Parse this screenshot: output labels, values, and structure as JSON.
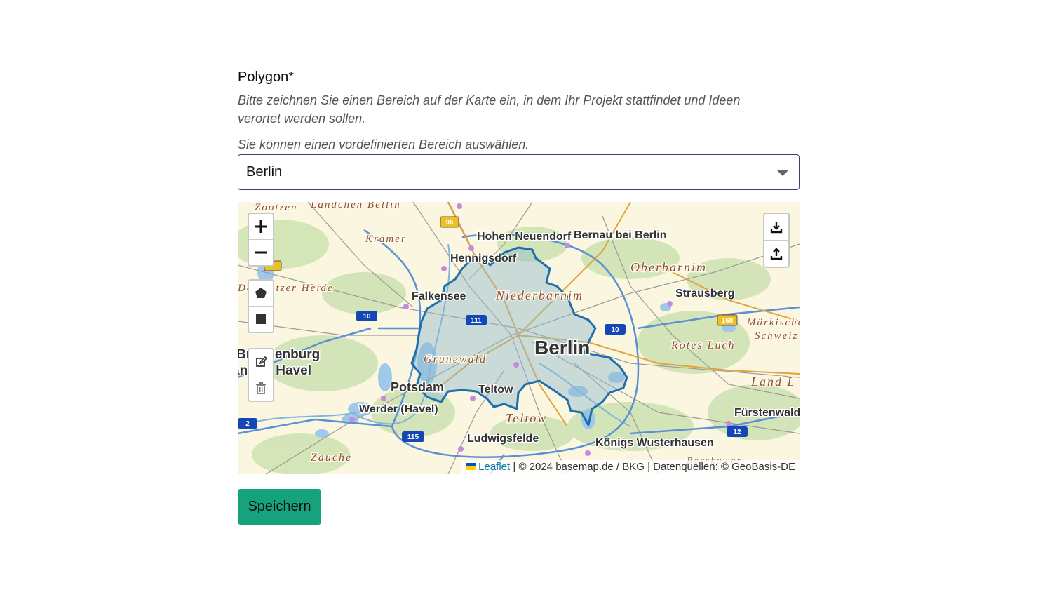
{
  "form": {
    "label": "Polygon*",
    "help": "Bitte zeichnen Sie einen Bereich auf der Karte ein, in dem Ihr Projekt stattfindet und Ideen verortet werden sollen.",
    "preset_hint": "Sie können einen vordefinierten Bereich auswählen.",
    "preset_value": "Berlin",
    "save_label": "Speichern"
  },
  "map": {
    "places": {
      "zootzen": "Zootzen",
      "landchen": "Ländchen Bellin",
      "kramer": "Krämer",
      "hohen": "Hohen Neuendorf",
      "bernau": "Bernau bei Berlin",
      "hennigsdorf": "Hennigsdorf",
      "oberbarnim": "Oberbarnim",
      "heide": "Döberitzer Heide",
      "falkensee": "Falkensee",
      "niederbarnim": "Niederbarnim",
      "strausberg": "Strausberg",
      "maerkische": "Märkische",
      "schweiz": "Schweiz",
      "berlin": "Berlin",
      "roteluch": "Rotes Luch",
      "brandenburg": "Brandenburg",
      "havel": "an der Havel",
      "grunewald": "Grunewald",
      "landl": "Land L",
      "potsdam": "Potsdam",
      "teltow_town": "Teltow",
      "werder": "Werder (Havel)",
      "fuerstenwalde": "Fürstenwalde",
      "teltow_region": "Teltow",
      "ludwigsfelde": "Ludwigsfelde",
      "koenigs": "Königs Wusterhausen",
      "zauche": "Zauche",
      "beeskow": "Beeskower"
    },
    "roads": {
      "b96": "96",
      "a10w": "10",
      "a111": "111",
      "a10e": "10",
      "b168": "168",
      "a2": "2",
      "a115": "115",
      "a12": "12"
    },
    "attribution": {
      "leaflet": "Leaflet",
      "text": "| © 2024 basemap.de / BKG | Datenquellen: © GeoBasis-DE"
    },
    "colors": {
      "polygon_stroke": "#1f6fae",
      "polygon_fill": "#8fb7cf",
      "save_button": "#15a27c"
    },
    "icons": {
      "zoom_in": "plus-icon",
      "zoom_out": "minus-icon",
      "draw_polygon": "pentagon-icon",
      "draw_rectangle": "square-icon",
      "edit": "edit-icon",
      "delete": "trash-icon",
      "export": "download-icon",
      "import": "upload-icon"
    }
  }
}
